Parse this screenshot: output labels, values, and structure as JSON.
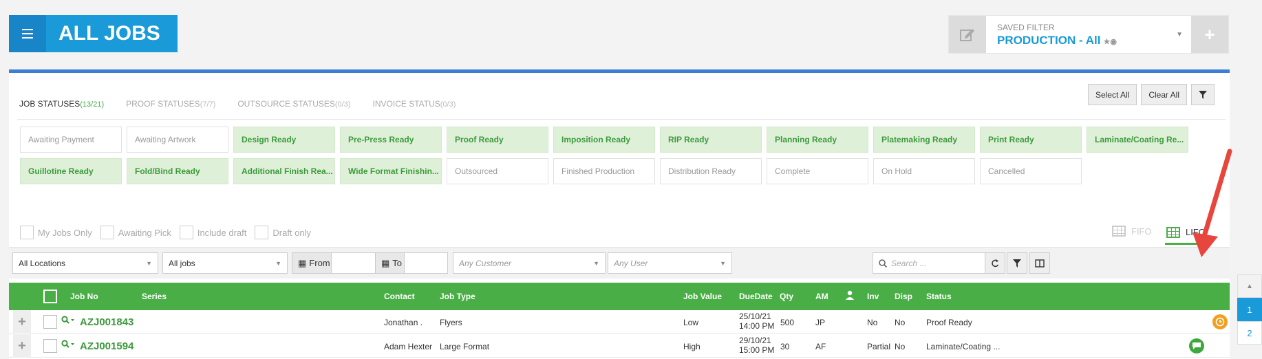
{
  "header": {
    "title": "ALL JOBS",
    "saved_filter_label": "SAVED FILTER",
    "saved_filter_value": "PRODUCTION - All",
    "saved_filter_suffix": "★◉"
  },
  "tabs": [
    {
      "label": "JOB STATUSES",
      "count": "(13/21)",
      "active": true
    },
    {
      "label": "PROOF STATUSES",
      "count": "(7/7)",
      "active": false
    },
    {
      "label": "OUTSOURCE STATUSES",
      "count": "(0/3)",
      "active": false
    },
    {
      "label": "INVOICE STATUS",
      "count": "(0/3)",
      "active": false
    }
  ],
  "buttons": {
    "select_all": "Select All",
    "clear_all": "Clear All"
  },
  "statuses": [
    {
      "label": "Awaiting Payment",
      "on": false
    },
    {
      "label": "Awaiting Artwork",
      "on": false
    },
    {
      "label": "Design Ready",
      "on": true
    },
    {
      "label": "Pre-Press Ready",
      "on": true
    },
    {
      "label": "Proof Ready",
      "on": true
    },
    {
      "label": "Imposition Ready",
      "on": true
    },
    {
      "label": "RIP Ready",
      "on": true
    },
    {
      "label": "Planning Ready",
      "on": true
    },
    {
      "label": "Platemaking Ready",
      "on": true
    },
    {
      "label": "Print Ready",
      "on": true
    },
    {
      "label": "Laminate/Coating Re...",
      "on": true
    },
    {
      "label": "Guillotine Ready",
      "on": true
    },
    {
      "label": "Fold/Bind Ready",
      "on": true
    },
    {
      "label": "Additional Finish Rea...",
      "on": true
    },
    {
      "label": "Wide Format Finishin...",
      "on": true
    },
    {
      "label": "Outsourced",
      "on": false
    },
    {
      "label": "Finished Production",
      "on": false
    },
    {
      "label": "Distribution Ready",
      "on": false
    },
    {
      "label": "Complete",
      "on": false
    },
    {
      "label": "On Hold",
      "on": false
    },
    {
      "label": "Cancelled",
      "on": false
    }
  ],
  "checks": {
    "my_jobs": "My Jobs Only",
    "awaiting_pick": "Awaiting Pick",
    "include_draft": "Include draft",
    "draft_only": "Draft only"
  },
  "sort": {
    "fifo": "FIFO",
    "lifo": "LIFO"
  },
  "filters": {
    "location": "All Locations",
    "jobs": "All jobs",
    "from": "From",
    "to": "To",
    "customer_placeholder": "Any Customer",
    "user_placeholder": "Any User",
    "search_placeholder": "Search ..."
  },
  "table": {
    "headers": {
      "job_no": "Job No",
      "series": "Series",
      "contact": "Contact",
      "job_type": "Job Type",
      "job_value": "Job Value",
      "due_date": "DueDate",
      "qty": "Qty",
      "am": "AM",
      "inv": "Inv",
      "disp": "Disp",
      "status": "Status"
    },
    "rows": [
      {
        "job_no": "AZJ001843",
        "contact": "Jonathan .",
        "job_type": "Flyers",
        "job_value": "Low",
        "due_date": "25/10/21",
        "due_time": "14:00 PM",
        "qty": "500",
        "am": "JP",
        "inv": "No",
        "disp": "No",
        "status": "Proof Ready",
        "badge": "clock-icon",
        "badge_color": "#f0a020"
      },
      {
        "job_no": "AZJ001594",
        "contact": "Adam Hexter",
        "job_type": "Large Format",
        "job_value": "High",
        "due_date": "29/10/21",
        "due_time": "15:00 PM",
        "qty": "30",
        "am": "AF",
        "inv": "Partial",
        "disp": "No",
        "status": "Laminate/Coating ...",
        "badge": "chat-icon",
        "badge_color": "#3ea83e"
      }
    ]
  },
  "pager": {
    "pages": [
      "1",
      "2"
    ],
    "current": "1"
  },
  "colors": {
    "accent_blue": "#1a9ad9",
    "green": "#4aae46",
    "annotation_red": "#e8453c"
  }
}
